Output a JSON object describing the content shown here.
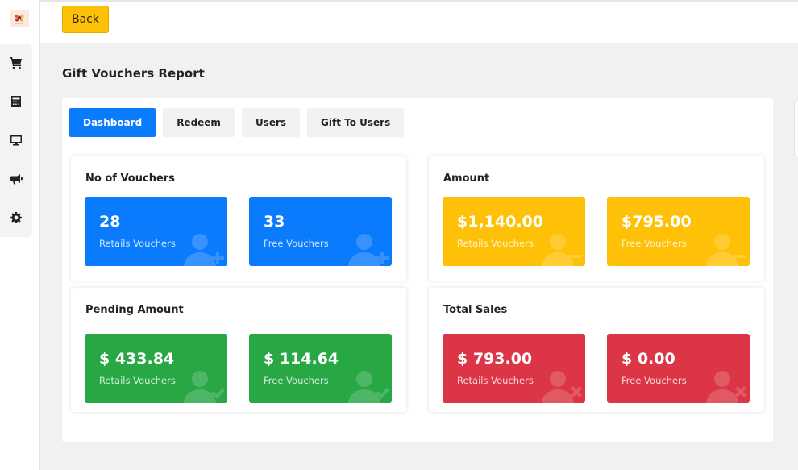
{
  "app": {
    "logo_icon": "flower-logo-icon"
  },
  "sidebar": {
    "items": [
      {
        "icon": "cart-icon",
        "name": "sidebar-item-cart"
      },
      {
        "icon": "calculator-icon",
        "name": "sidebar-item-calculator"
      },
      {
        "icon": "monitor-icon",
        "name": "sidebar-item-monitor"
      },
      {
        "icon": "megaphone-icon",
        "name": "sidebar-item-megaphone"
      },
      {
        "icon": "gear-icon",
        "name": "sidebar-item-settings"
      }
    ]
  },
  "topbar": {
    "back_label": "Back"
  },
  "page": {
    "title": "Gift Vouchers Report"
  },
  "tabs": [
    {
      "label": "Dashboard",
      "active": true
    },
    {
      "label": "Redeem",
      "active": false
    },
    {
      "label": "Users",
      "active": false
    },
    {
      "label": "Gift To Users",
      "active": false
    }
  ],
  "sections": {
    "vouchers": {
      "title": "No of Vouchers",
      "retail": {
        "value": "28",
        "label": "Retails Vouchers"
      },
      "free": {
        "value": "33",
        "label": "Free Vouchers"
      }
    },
    "amount": {
      "title": "Amount",
      "retail": {
        "value": "$1,140.00",
        "label": "Retails Vouchers"
      },
      "free": {
        "value": "$795.00",
        "label": "Free Vouchers"
      }
    },
    "pending": {
      "title": "Pending Amount",
      "retail": {
        "value": "$ 433.84",
        "label": "Retails Vouchers"
      },
      "free": {
        "value": "$ 114.64",
        "label": "Free Vouchers"
      }
    },
    "sales": {
      "title": "Total Sales",
      "retail": {
        "value": "$ 793.00",
        "label": "Retails Vouchers"
      },
      "free": {
        "value": "$ 0.00",
        "label": "Free Vouchers"
      }
    }
  },
  "colors": {
    "primary": "#0b7bfd",
    "warning": "#ffc107",
    "success": "#28a745",
    "danger": "#dc3545"
  }
}
